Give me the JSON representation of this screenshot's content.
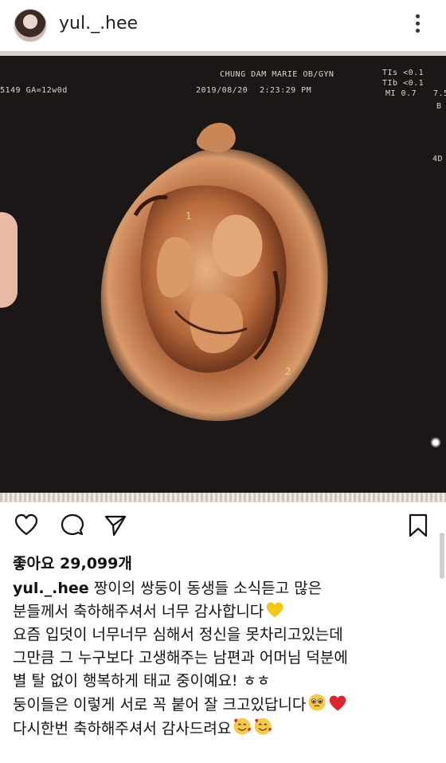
{
  "header": {
    "username": "yul._.hee"
  },
  "photo": {
    "clinic": "CHUNG DAM MARIE OB/GYN",
    "date": "2019/08/20",
    "time": "2:23:29 PM",
    "id_ga": "5149  GA=12w0d",
    "tis": "TIs <0.1",
    "tib": "TIb <0.1",
    "mi": "MI  0.7",
    "right_num": "7.5",
    "right_b": "B",
    "mode": "4D",
    "marker1": "1",
    "marker2": "2"
  },
  "post": {
    "likes": "좋아요 29,099개",
    "caption_username": "yul._.hee",
    "lines": [
      "짱이의 쌍둥이 동생들 소식듣고 많은",
      "분들께서 축하해주셔서 너무 감사합니다",
      "요즘 입덧이 너무너무 심해서 정신을 못차리고있는데",
      "그만큼 그 누구보다 고생해주는 남편과 어머님 덕분에",
      "별 탈 없이 행복하게 태교 중이예요! ㅎㅎ",
      "둥이들은 이렇게 서로 꼭 붙어 잘 크고있답니다",
      "다시한번 축하해주셔서 감사드려요"
    ]
  },
  "colors": {
    "heart_red": "#e0242f",
    "heart_yellow": "#f5c518",
    "scan_orange": "#c97a4a"
  },
  "icons": [
    "heart-icon",
    "comment-icon",
    "share-icon",
    "bookmark-icon",
    "more-options-icon"
  ]
}
